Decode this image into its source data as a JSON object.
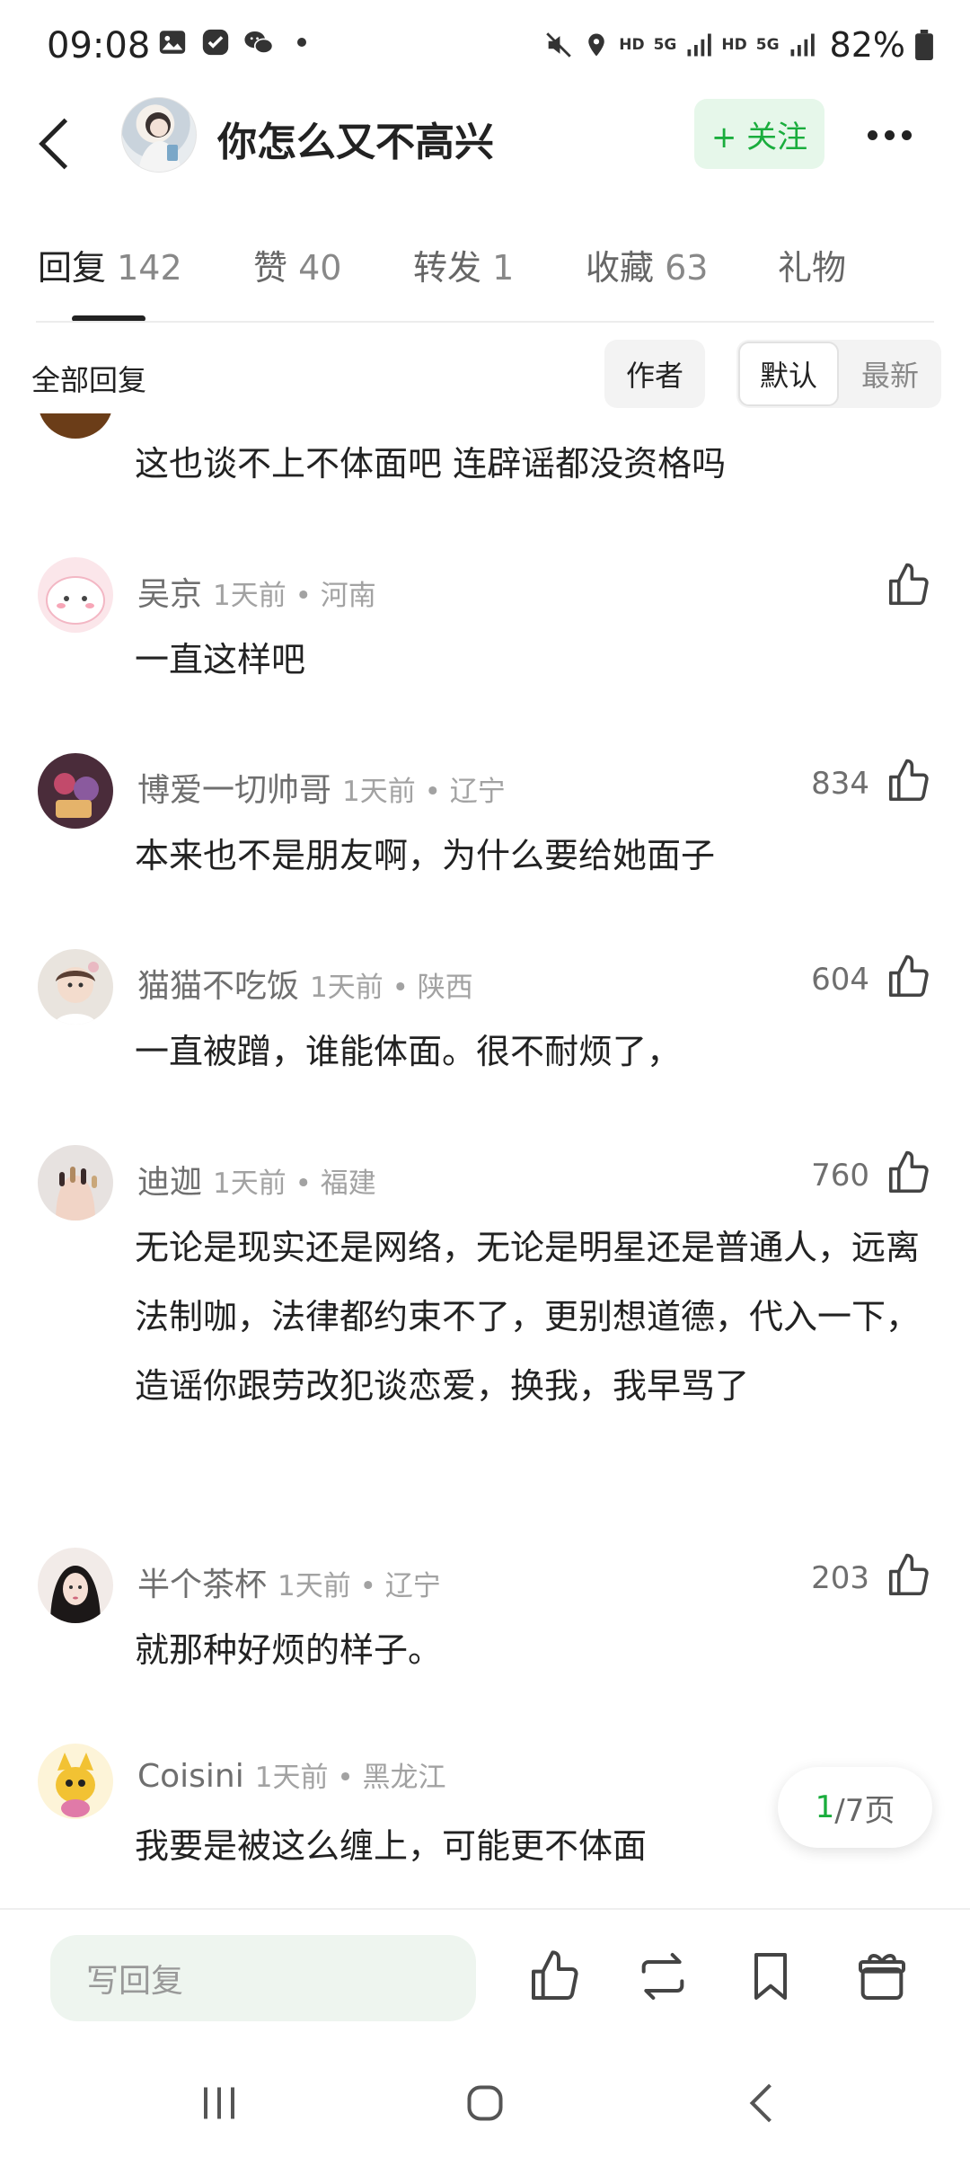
{
  "status_bar": {
    "time": "09:08",
    "battery": "82%",
    "hd1": "HD",
    "hd2": "HD",
    "net1": "5G",
    "net2": "5G"
  },
  "header": {
    "title": "你怎么又不高兴",
    "follow_label": "+ 关注"
  },
  "tabs": [
    {
      "label": "回复",
      "count": "142"
    },
    {
      "label": "赞",
      "count": "40"
    },
    {
      "label": "转发",
      "count": "1"
    },
    {
      "label": "收藏",
      "count": "63"
    },
    {
      "label": "礼物",
      "count": ""
    }
  ],
  "filter": {
    "all_label": "全部回复",
    "author_label": "作者",
    "default_label": "默认",
    "latest_label": "最新"
  },
  "first_comment_text": "这也谈不上不体面吧  连辟谣都没资格吗",
  "comments": [
    {
      "name": "吴京",
      "meta": "1天前 • 河南",
      "likes": "",
      "text": "一直这样吧"
    },
    {
      "name": "博爱一切帅哥",
      "meta": "1天前 • 辽宁",
      "likes": "834",
      "text": "本来也不是朋友啊，为什么要给她面子"
    },
    {
      "name": "猫猫不吃饭",
      "meta": "1天前 • 陕西",
      "likes": "604",
      "text": "一直被蹭，谁能体面。很不耐烦了，"
    },
    {
      "name": "迪迦",
      "meta": "1天前 • 福建",
      "likes": "760",
      "text": "无论是现实还是网络，无论是明星还是普通人，远离法制咖，法律都约束不了，更别想道德，代入一下，造谣你跟劳改犯谈恋爱，换我，我早骂了"
    },
    {
      "name": "半个茶杯",
      "meta": "1天前 • 辽宁",
      "likes": "203",
      "text": "就那种好烦的样子。"
    },
    {
      "name": "Coisini",
      "meta": "1天前 • 黑龙江",
      "likes": "",
      "text": "我要是被这么缠上，可能更不体面"
    }
  ],
  "pager": {
    "current": "1",
    "rest": "/7页"
  },
  "bottom": {
    "reply_placeholder": "写回复"
  },
  "colors": {
    "accent": "#1aad3d",
    "follow_bg": "#e6f7ea"
  }
}
